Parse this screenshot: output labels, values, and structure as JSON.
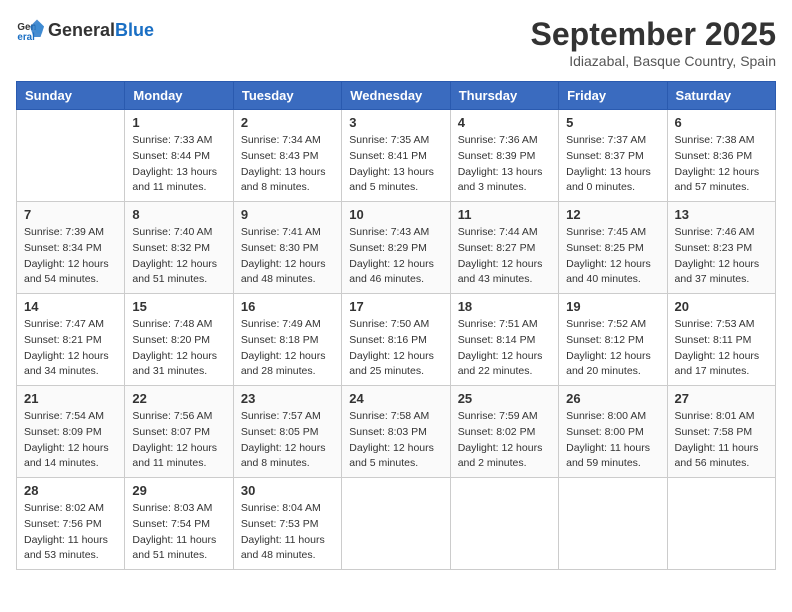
{
  "header": {
    "logo_general": "General",
    "logo_blue": "Blue",
    "month": "September 2025",
    "location": "Idiazabal, Basque Country, Spain"
  },
  "weekdays": [
    "Sunday",
    "Monday",
    "Tuesday",
    "Wednesday",
    "Thursday",
    "Friday",
    "Saturday"
  ],
  "weeks": [
    [
      {
        "day": "",
        "info": ""
      },
      {
        "day": "1",
        "info": "Sunrise: 7:33 AM\nSunset: 8:44 PM\nDaylight: 13 hours\nand 11 minutes."
      },
      {
        "day": "2",
        "info": "Sunrise: 7:34 AM\nSunset: 8:43 PM\nDaylight: 13 hours\nand 8 minutes."
      },
      {
        "day": "3",
        "info": "Sunrise: 7:35 AM\nSunset: 8:41 PM\nDaylight: 13 hours\nand 5 minutes."
      },
      {
        "day": "4",
        "info": "Sunrise: 7:36 AM\nSunset: 8:39 PM\nDaylight: 13 hours\nand 3 minutes."
      },
      {
        "day": "5",
        "info": "Sunrise: 7:37 AM\nSunset: 8:37 PM\nDaylight: 13 hours\nand 0 minutes."
      },
      {
        "day": "6",
        "info": "Sunrise: 7:38 AM\nSunset: 8:36 PM\nDaylight: 12 hours\nand 57 minutes."
      }
    ],
    [
      {
        "day": "7",
        "info": "Sunrise: 7:39 AM\nSunset: 8:34 PM\nDaylight: 12 hours\nand 54 minutes."
      },
      {
        "day": "8",
        "info": "Sunrise: 7:40 AM\nSunset: 8:32 PM\nDaylight: 12 hours\nand 51 minutes."
      },
      {
        "day": "9",
        "info": "Sunrise: 7:41 AM\nSunset: 8:30 PM\nDaylight: 12 hours\nand 48 minutes."
      },
      {
        "day": "10",
        "info": "Sunrise: 7:43 AM\nSunset: 8:29 PM\nDaylight: 12 hours\nand 46 minutes."
      },
      {
        "day": "11",
        "info": "Sunrise: 7:44 AM\nSunset: 8:27 PM\nDaylight: 12 hours\nand 43 minutes."
      },
      {
        "day": "12",
        "info": "Sunrise: 7:45 AM\nSunset: 8:25 PM\nDaylight: 12 hours\nand 40 minutes."
      },
      {
        "day": "13",
        "info": "Sunrise: 7:46 AM\nSunset: 8:23 PM\nDaylight: 12 hours\nand 37 minutes."
      }
    ],
    [
      {
        "day": "14",
        "info": "Sunrise: 7:47 AM\nSunset: 8:21 PM\nDaylight: 12 hours\nand 34 minutes."
      },
      {
        "day": "15",
        "info": "Sunrise: 7:48 AM\nSunset: 8:20 PM\nDaylight: 12 hours\nand 31 minutes."
      },
      {
        "day": "16",
        "info": "Sunrise: 7:49 AM\nSunset: 8:18 PM\nDaylight: 12 hours\nand 28 minutes."
      },
      {
        "day": "17",
        "info": "Sunrise: 7:50 AM\nSunset: 8:16 PM\nDaylight: 12 hours\nand 25 minutes."
      },
      {
        "day": "18",
        "info": "Sunrise: 7:51 AM\nSunset: 8:14 PM\nDaylight: 12 hours\nand 22 minutes."
      },
      {
        "day": "19",
        "info": "Sunrise: 7:52 AM\nSunset: 8:12 PM\nDaylight: 12 hours\nand 20 minutes."
      },
      {
        "day": "20",
        "info": "Sunrise: 7:53 AM\nSunset: 8:11 PM\nDaylight: 12 hours\nand 17 minutes."
      }
    ],
    [
      {
        "day": "21",
        "info": "Sunrise: 7:54 AM\nSunset: 8:09 PM\nDaylight: 12 hours\nand 14 minutes."
      },
      {
        "day": "22",
        "info": "Sunrise: 7:56 AM\nSunset: 8:07 PM\nDaylight: 12 hours\nand 11 minutes."
      },
      {
        "day": "23",
        "info": "Sunrise: 7:57 AM\nSunset: 8:05 PM\nDaylight: 12 hours\nand 8 minutes."
      },
      {
        "day": "24",
        "info": "Sunrise: 7:58 AM\nSunset: 8:03 PM\nDaylight: 12 hours\nand 5 minutes."
      },
      {
        "day": "25",
        "info": "Sunrise: 7:59 AM\nSunset: 8:02 PM\nDaylight: 12 hours\nand 2 minutes."
      },
      {
        "day": "26",
        "info": "Sunrise: 8:00 AM\nSunset: 8:00 PM\nDaylight: 11 hours\nand 59 minutes."
      },
      {
        "day": "27",
        "info": "Sunrise: 8:01 AM\nSunset: 7:58 PM\nDaylight: 11 hours\nand 56 minutes."
      }
    ],
    [
      {
        "day": "28",
        "info": "Sunrise: 8:02 AM\nSunset: 7:56 PM\nDaylight: 11 hours\nand 53 minutes."
      },
      {
        "day": "29",
        "info": "Sunrise: 8:03 AM\nSunset: 7:54 PM\nDaylight: 11 hours\nand 51 minutes."
      },
      {
        "day": "30",
        "info": "Sunrise: 8:04 AM\nSunset: 7:53 PM\nDaylight: 11 hours\nand 48 minutes."
      },
      {
        "day": "",
        "info": ""
      },
      {
        "day": "",
        "info": ""
      },
      {
        "day": "",
        "info": ""
      },
      {
        "day": "",
        "info": ""
      }
    ]
  ]
}
